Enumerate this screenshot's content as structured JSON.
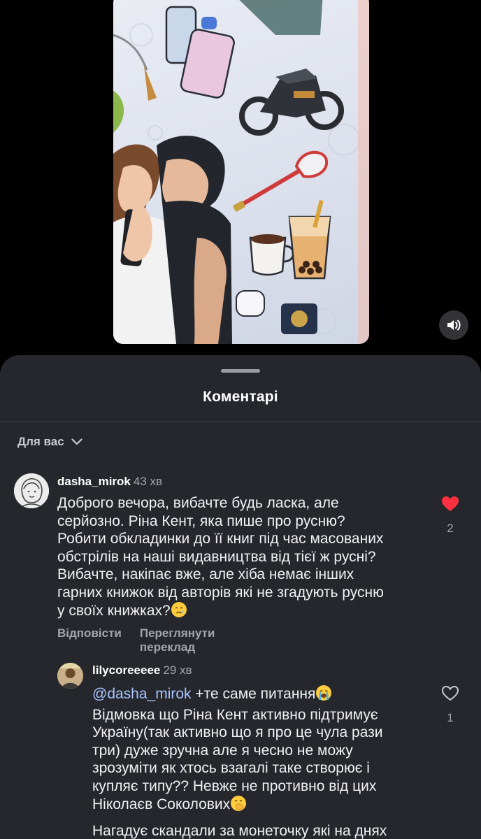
{
  "media": {
    "sound_icon": "speaker-icon"
  },
  "comments_sheet": {
    "title": "Коментарі",
    "sort": {
      "label": "Для вас",
      "icon": "chevron-down-icon"
    }
  },
  "comments": [
    {
      "username": "dasha_mirok",
      "time": "43 хв",
      "text_lines": [
        "Доброго вечора, вибачте будь ласка, але",
        "серйозно. Ріна Кент, яка пише про русню?",
        "Робити обкладинки до її книг під час масованих",
        "обстрілів на наші видавництва від тієї ж русні?",
        "Вибачте, накіпає вже, але хіба немає інших",
        "гарних книжок від авторів які не згадують русню",
        "у своїх книжках?"
      ],
      "emoji": "crying-face-emoji",
      "reply_label": "Відповісти",
      "translate_label": "Переглянути переклад",
      "like_icon": "heart-filled-icon",
      "like_color": "#ff3040",
      "likes": "2"
    },
    {
      "username": "lilycoreeeee",
      "time": "29 хв",
      "mention": "@dasha_mirok",
      "first_line_rest": " +те саме питання",
      "first_line_emoji": "loudly-crying-face-emoji",
      "text_lines": [
        "Відмовка що Ріна Кент активно підтримує",
        "Україну(так активно що я про це чула рази",
        "три) дуже зручна але я чесно не можу",
        "зрозуміти як хтось взагалі таке створює і",
        "купляє типу?? Невже не противно від цих",
        "Ніколаєв Соколових",
        "Нагадує скандали за монеточку які на днях"
      ],
      "line6_emoji": "face-with-hand-over-mouth-emoji",
      "like_icon": "heart-outline-icon",
      "likes": "1"
    }
  ]
}
